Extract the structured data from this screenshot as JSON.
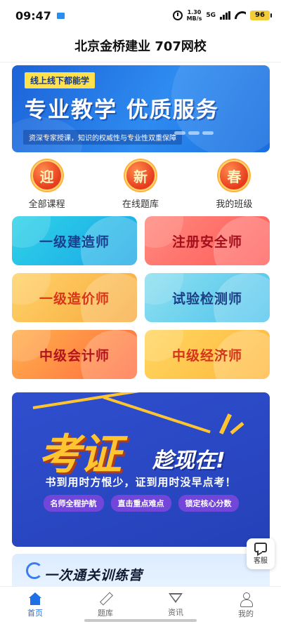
{
  "status_bar": {
    "time": "09:47",
    "net_speed_value": "1.30",
    "net_speed_unit": "MB/s",
    "network_type": "5G",
    "battery": "96"
  },
  "header": {
    "title": "北京金桥建业 707网校"
  },
  "hero_banner": {
    "tag": "线上线下都能学",
    "headline": "专业教学  优质服务",
    "subtitle": "资深专家授课，知识的权威性与专业性双重保障"
  },
  "quick_nav": [
    {
      "badge": "迎",
      "label": "全部课程"
    },
    {
      "badge": "新",
      "label": "在线题库"
    },
    {
      "badge": "春",
      "label": "我的班级"
    }
  ],
  "categories": [
    {
      "label": "一级建造师"
    },
    {
      "label": "注册安全师"
    },
    {
      "label": "一级造价师"
    },
    {
      "label": "试验检测师"
    },
    {
      "label": "中级会计师"
    },
    {
      "label": "中级经济师"
    }
  ],
  "exam_banner": {
    "big_text": "考证",
    "small_text": "趁现在!",
    "slogan": "书到用时方恨少，证到用时没早点考！",
    "pills": [
      "名师全程护航",
      "直击重点难点",
      "锁定核心分数"
    ]
  },
  "camp_banner": {
    "title": "一次通关训练营"
  },
  "customer_service": {
    "label": "客服"
  },
  "tab_bar": [
    {
      "label": "首页",
      "icon": "home-icon",
      "active": true
    },
    {
      "label": "题库",
      "icon": "pencil-icon",
      "active": false
    },
    {
      "label": "资讯",
      "icon": "news-icon",
      "active": false
    },
    {
      "label": "我的",
      "icon": "user-icon",
      "active": false
    }
  ],
  "colors": {
    "accent": "#1f6fe6",
    "badge_red": "#e73b1d",
    "exam_yellow": "#ffc531"
  }
}
